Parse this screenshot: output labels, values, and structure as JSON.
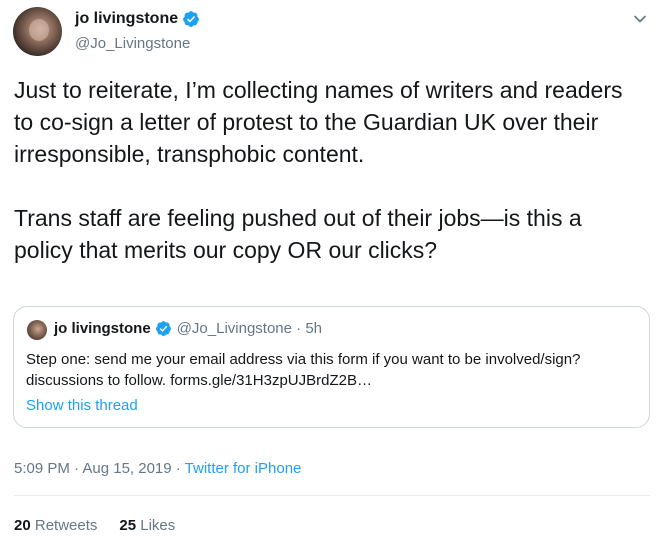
{
  "author": {
    "display_name": "jo livingstone",
    "handle": "@Jo_Livingstone",
    "verified_icon": "verified-badge-icon"
  },
  "tweet": {
    "text": "Just to reiterate, I’m collecting names of writers and readers to co-sign a letter of protest to the Guardian UK over their irresponsible, transphobic content.\n\nTrans staff are feeling pushed out of their jobs—is this a policy that merits our copy OR our clicks?"
  },
  "quoted_tweet": {
    "display_name": "jo livingstone",
    "handle_time": "@Jo_Livingstone · 5h",
    "text": "Step one: send me your email address via this form if you want to be involved/sign? discussions to follow. forms.gle/31H3zpUJBrdZ2B…",
    "show_thread_label": "Show this thread"
  },
  "meta": {
    "timestamp": "5:09 PM · Aug 15, 2019 · ",
    "source": "Twitter for iPhone"
  },
  "stats": {
    "retweets_count": "20",
    "retweets_label": " Retweets",
    "likes_count": "25",
    "likes_label": " Likes"
  },
  "colors": {
    "accent": "#1da1f2",
    "secondary_text": "#657786",
    "primary_text": "#14171a",
    "border": "#ccd6dd"
  }
}
